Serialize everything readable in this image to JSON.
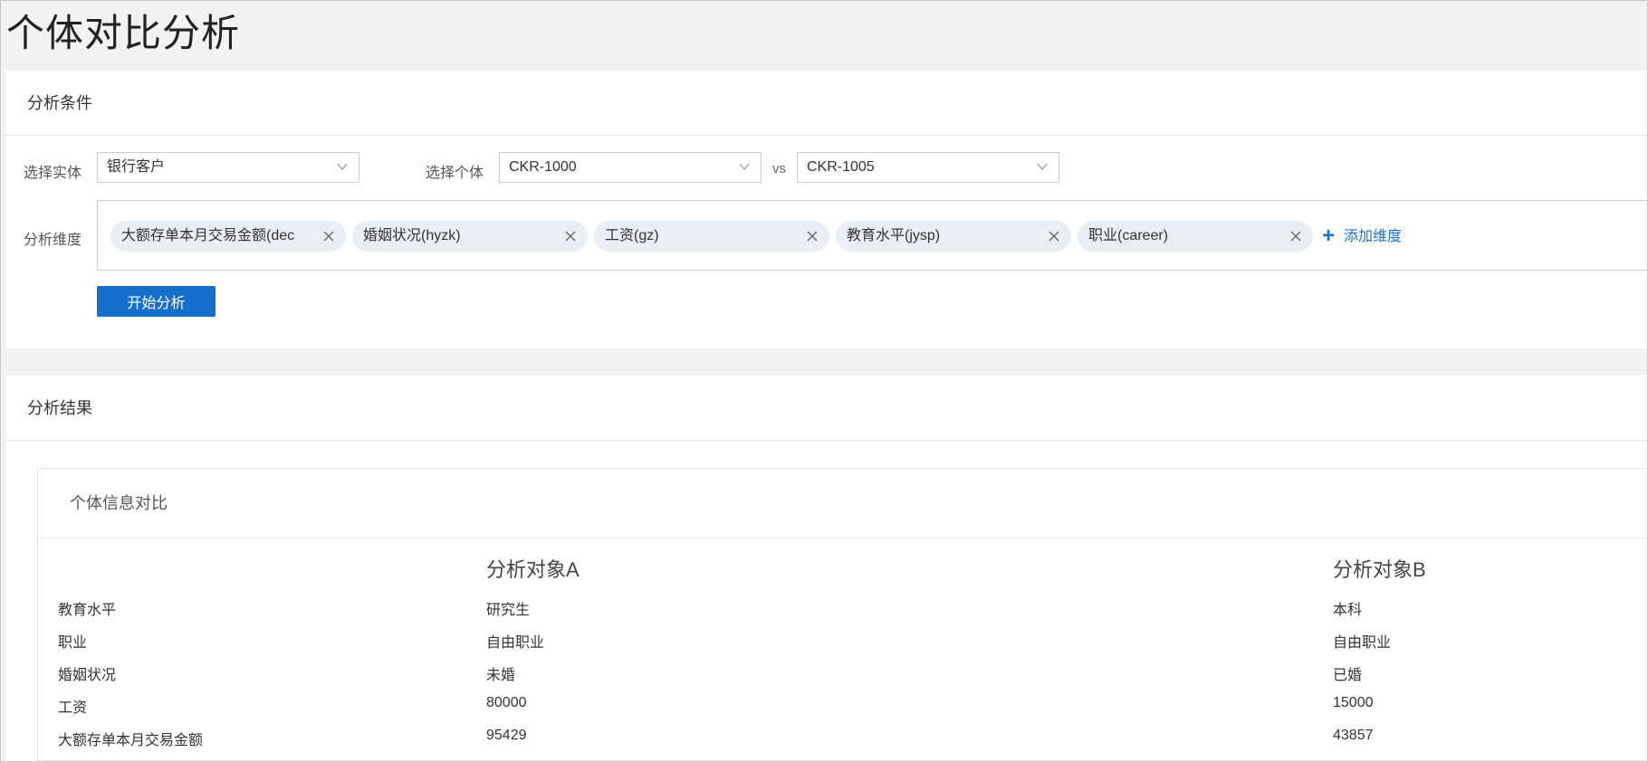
{
  "page": {
    "title": "个体对比分析"
  },
  "conditions": {
    "header": "分析条件",
    "entity_label": "选择实体",
    "entity_value": "银行客户",
    "individual_label": "选择个体",
    "individual_a": "CKR-1000",
    "vs": "vs",
    "individual_b": "CKR-1005",
    "dims_label": "分析维度",
    "dims": [
      {
        "label": "大额存单本月交易金额(dec"
      },
      {
        "label": "婚姻状况(hyzk)"
      },
      {
        "label": "工资(gz)"
      },
      {
        "label": "教育水平(jysp)"
      },
      {
        "label": "职业(career)"
      }
    ],
    "add_dim": "添加维度",
    "start_button": "开始分析"
  },
  "results": {
    "header": "分析结果",
    "card_title": "个体信息对比",
    "col_a": "分析对象A",
    "col_b": "分析对象B",
    "rows": [
      {
        "label": "教育水平",
        "a": "研究生",
        "b": "本科"
      },
      {
        "label": "职业",
        "a": "自由职业",
        "b": "自由职业"
      },
      {
        "label": "婚姻状况",
        "a": "未婚",
        "b": "已婚"
      },
      {
        "label": "工资",
        "a": "80000",
        "b": "15000"
      },
      {
        "label": "大额存单本月交易金额",
        "a": "95429",
        "b": "43857"
      }
    ]
  },
  "colors": {
    "accent": "#1570cc",
    "link": "#1a73c9",
    "tag_bg": "#e9eef4"
  }
}
